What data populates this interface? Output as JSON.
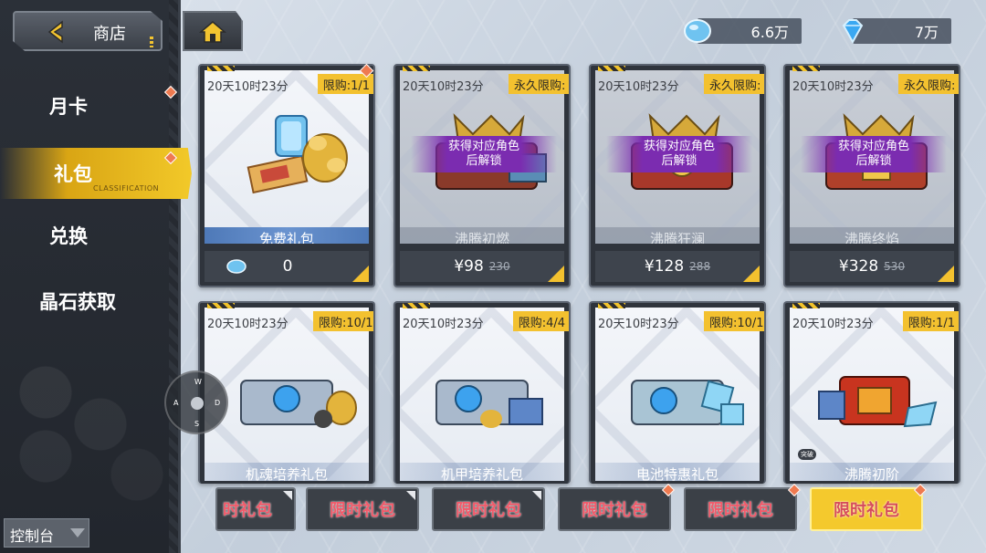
{
  "top_bar": {
    "back_label": "商店",
    "crystal_amount": "6.6万",
    "diamond_amount": "7万"
  },
  "sidebar": {
    "items": [
      {
        "label": "月卡"
      },
      {
        "label": "礼包",
        "sub": "CLASSIFICATION"
      },
      {
        "label": "兑换"
      },
      {
        "label": "晶石获取"
      }
    ],
    "console_label": "控制台"
  },
  "cards": [
    {
      "timer": "20天10时23分",
      "limit": "限购:1/1",
      "name": "免费礼包",
      "price": "0"
    },
    {
      "timer": "20天10时23分",
      "limit": "永久限购:",
      "name": "沸腾初燃",
      "lock_line1": "获得对应角色",
      "lock_line2": "后解锁",
      "price": "¥98",
      "old_price": "230"
    },
    {
      "timer": "20天10时23分",
      "limit": "永久限购:",
      "name": "沸腾狂澜",
      "lock_line1": "获得对应角色",
      "lock_line2": "后解锁",
      "price": "¥128",
      "old_price": "288"
    },
    {
      "timer": "20天10时23分",
      "limit": "永久限购:",
      "name": "沸腾终焰",
      "lock_line1": "获得对应角色",
      "lock_line2": "后解锁",
      "price": "¥328",
      "old_price": "530"
    },
    {
      "timer": "20天10时23分",
      "limit": "限购:10/1",
      "name": "机魂培养礼包"
    },
    {
      "timer": "20天10时23分",
      "limit": "限购:4/4",
      "name": "机甲培养礼包"
    },
    {
      "timer": "20天10时23分",
      "limit": "限购:10/1",
      "name": "电池特惠礼包"
    },
    {
      "timer": "20天10时23分",
      "limit": "限购:1/1",
      "name": "沸腾初阶",
      "badge": "突破"
    }
  ],
  "tabs": [
    {
      "label": "时礼包"
    },
    {
      "label": "限时礼包"
    },
    {
      "label": "限时礼包"
    },
    {
      "label": "限时礼包"
    },
    {
      "label": "限时礼包"
    },
    {
      "label": "限时礼包"
    }
  ],
  "joystick": {
    "w": "W",
    "a": "A",
    "s": "S",
    "d": "D"
  }
}
